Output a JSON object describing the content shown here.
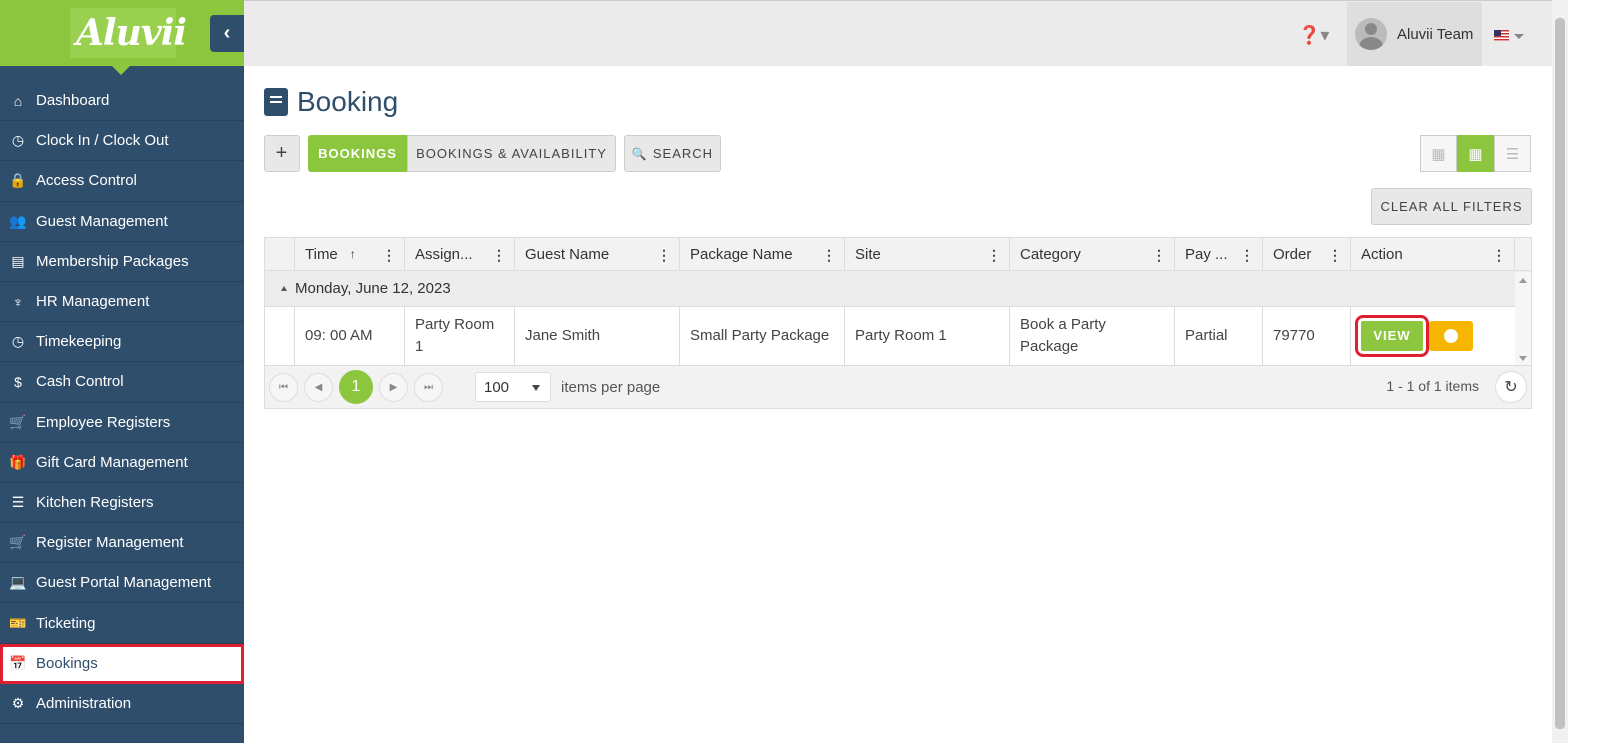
{
  "app": {
    "logo": "Aluvii"
  },
  "sidebar": {
    "items": [
      {
        "label": "Dashboard",
        "icon": "home-icon",
        "glyph": "⌂"
      },
      {
        "label": "Clock In / Clock Out",
        "icon": "clock-icon",
        "glyph": "◷"
      },
      {
        "label": "Access Control",
        "icon": "lock-icon",
        "glyph": "🔒"
      },
      {
        "label": "Guest Management",
        "icon": "users-icon",
        "glyph": "👥"
      },
      {
        "label": "Membership Packages",
        "icon": "card-icon",
        "glyph": "▤"
      },
      {
        "label": "HR Management",
        "icon": "tie-icon",
        "glyph": "♆"
      },
      {
        "label": "Timekeeping",
        "icon": "clock-icon",
        "glyph": "◷"
      },
      {
        "label": "Cash Control",
        "icon": "dollar-icon",
        "glyph": "$"
      },
      {
        "label": "Employee Registers",
        "icon": "cart-icon",
        "glyph": "🛒"
      },
      {
        "label": "Gift Card Management",
        "icon": "gift-icon",
        "glyph": "🎁"
      },
      {
        "label": "Kitchen Registers",
        "icon": "list-icon",
        "glyph": "☰"
      },
      {
        "label": "Register Management",
        "icon": "cart-plus-icon",
        "glyph": "🛒"
      },
      {
        "label": "Guest Portal Management",
        "icon": "laptop-icon",
        "glyph": "💻"
      },
      {
        "label": "Ticketing",
        "icon": "ticket-icon",
        "glyph": "🎫"
      },
      {
        "label": "Bookings",
        "icon": "calendar-plus-icon",
        "glyph": "📅"
      },
      {
        "label": "Administration",
        "icon": "cogs-icon",
        "glyph": "⚙"
      }
    ],
    "active": "Bookings"
  },
  "topbar": {
    "user_name": "Aluvii Team"
  },
  "page": {
    "title": "Booking"
  },
  "toolbar": {
    "add_label": "+",
    "bookings_label": "BOOKINGS",
    "availability_label": "BOOKINGS & AVAILABILITY",
    "search_label": "SEARCH",
    "clear_filters_label": "CLEAR ALL FILTERS"
  },
  "grid": {
    "columns": [
      "Time",
      "Assign...",
      "Guest Name",
      "Package Name",
      "Site",
      "Category",
      "Pay ...",
      "Order",
      "Action"
    ],
    "sort_indicator": "↑",
    "group_label": "Monday, June 12, 2023",
    "rows": [
      {
        "time": "09: 00 AM",
        "assigned": "Party Room 1",
        "guest_name": "Jane Smith",
        "package_name": "Small Party Package",
        "site": "Party Room 1",
        "category": "Book a Party Package",
        "pay": "Partial",
        "order": "79770",
        "action_label": "VIEW"
      }
    ]
  },
  "pager": {
    "current_page": "1",
    "page_size": "100",
    "page_size_label": "items per page",
    "info": "1 - 1 of 1 items"
  },
  "colors": {
    "brand_green": "#8cc63f",
    "sidebar_blue": "#2f4e6b",
    "toggle_yellow": "#f7b500",
    "highlight_red": "#e02030"
  }
}
